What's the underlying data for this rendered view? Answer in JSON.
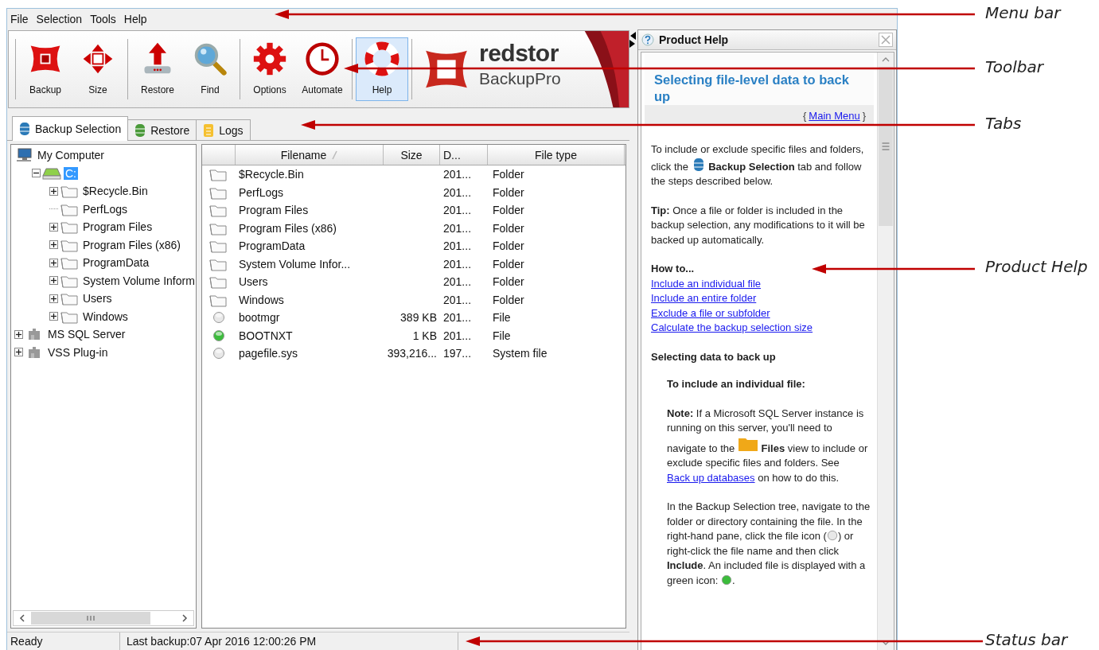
{
  "menu": [
    "File",
    "Selection",
    "Tools",
    "Help"
  ],
  "toolbar": {
    "groups": [
      [
        {
          "label": "Backup",
          "kind": "backup",
          "selected": false
        },
        {
          "label": "Size",
          "kind": "size",
          "selected": false
        }
      ],
      [
        {
          "label": "Restore",
          "kind": "restore",
          "selected": false
        },
        {
          "label": "Find",
          "kind": "find",
          "selected": false
        }
      ],
      [
        {
          "label": "Options",
          "kind": "options",
          "selected": false
        },
        {
          "label": "Automate",
          "kind": "automate",
          "selected": false
        }
      ],
      [
        {
          "label": "Help",
          "kind": "help",
          "selected": true
        }
      ]
    ],
    "logo": {
      "name": "redstor",
      "product": "BackupPro"
    }
  },
  "tabs": [
    {
      "label": "Backup Selection",
      "kind": "database",
      "selected": true
    },
    {
      "label": "Restore",
      "kind": "database",
      "selected": false
    },
    {
      "label": "Logs",
      "kind": "notes",
      "selected": false
    }
  ],
  "tree": [
    {
      "label": "My Computer",
      "kind": "computer",
      "expanded": true,
      "selected": false,
      "children": [
        {
          "label": "C:",
          "kind": "drive",
          "expandable": true,
          "expanded": true,
          "selected": true,
          "children": [
            {
              "label": "$Recycle.Bin",
              "kind": "folder",
              "expandable": true,
              "expanded": false,
              "selected": false
            },
            {
              "label": "PerfLogs",
              "kind": "folder",
              "expandable": false,
              "selected": false
            },
            {
              "label": "Program Files",
              "kind": "folder",
              "expandable": true,
              "expanded": false,
              "selected": false
            },
            {
              "label": "Program Files (x86)",
              "kind": "folder",
              "expandable": true,
              "expanded": false,
              "selected": false
            },
            {
              "label": "ProgramData",
              "kind": "folder",
              "expandable": true,
              "expanded": false,
              "selected": false
            },
            {
              "label": "System Volume Inform",
              "kind": "folder",
              "expandable": true,
              "expanded": false,
              "selected": false
            },
            {
              "label": "Users",
              "kind": "folder",
              "expandable": true,
              "expanded": false,
              "selected": false
            },
            {
              "label": "Windows",
              "kind": "folder",
              "expandable": true,
              "expanded": false,
              "selected": false
            }
          ]
        }
      ]
    },
    {
      "label": "MS SQL Server",
      "kind": "plugin",
      "expandable": true,
      "expanded": false,
      "selected": false
    },
    {
      "label": "VSS Plug-in",
      "kind": "plugin",
      "expandable": true,
      "expanded": false,
      "selected": false
    }
  ],
  "files": {
    "columns": [
      "Filename",
      "Size",
      "D...",
      "File type"
    ],
    "rows": [
      {
        "kind": "folder",
        "name": "$Recycle.Bin",
        "date": "201...",
        "type": "Folder"
      },
      {
        "kind": "folder",
        "name": "PerfLogs",
        "date": "201...",
        "type": "Folder"
      },
      {
        "kind": "folder",
        "name": "Program Files",
        "date": "201...",
        "type": "Folder"
      },
      {
        "kind": "folder",
        "name": "Program Files (x86)",
        "date": "201...",
        "type": "Folder"
      },
      {
        "kind": "folder",
        "name": "ProgramData",
        "date": "201...",
        "type": "Folder"
      },
      {
        "kind": "folder",
        "name": "System Volume Infor...",
        "date": "201...",
        "type": "Folder"
      },
      {
        "kind": "folder",
        "name": "Users",
        "date": "201...",
        "type": "Folder"
      },
      {
        "kind": "folder",
        "name": "Windows",
        "date": "201...",
        "type": "Folder"
      },
      {
        "kind": "file",
        "included": false,
        "name": "bootmgr",
        "size": "389 KB",
        "date": "201...",
        "type": "File"
      },
      {
        "kind": "file",
        "included": true,
        "name": "BOOTNXT",
        "size": "1 KB",
        "date": "201...",
        "type": "File"
      },
      {
        "kind": "file",
        "included": false,
        "name": "pagefile.sys",
        "size": "393,216...",
        "date": "197...",
        "type": "System file"
      }
    ]
  },
  "status_bar": [
    "Ready",
    "Last backup:07 Apr 2016 12:00:26 PM"
  ],
  "help": {
    "title": "Product Help",
    "heading": "Selecting file-level data to back up",
    "brace_open": "{",
    "main_menu": "Main Menu",
    "brace_close": "}",
    "blocks": [
      {
        "kind": "para",
        "parts": [
          {
            "kind": "text",
            "text": "To include or exclude specific files and folders, click the "
          },
          {
            "kind": "database"
          },
          {
            "kind": "text",
            "text": " **Backup Selection** tab and follow the steps described below."
          }
        ]
      },
      {
        "kind": "para",
        "parts": [
          {
            "kind": "text",
            "text": "**Tip:** Once a file or folder is included in the backup selection, any modifications to it will be backed up automatically."
          }
        ]
      },
      {
        "kind": "links",
        "title": "How to...",
        "items": [
          "Include an individual file",
          "Include an entire folder",
          "Exclude a file or subfolder",
          "Calculate the backup selection size"
        ]
      },
      {
        "kind": "section",
        "title": "Selecting data to back up",
        "children": [
          {
            "kind": "heading",
            "text": "To include an individual file:"
          },
          {
            "kind": "para",
            "parts": [
              {
                "kind": "text",
                "text": "**Note:** If a Microsoft SQL Server instance is running on this server, you'll need to navigate to the "
              },
              {
                "kind": "folder"
              },
              {
                "kind": "text",
                "text": " **Files** view to include or exclude specific files and folders. See "
              },
              {
                "kind": "link",
                "text": "Back up databases"
              },
              {
                "kind": "text",
                "text": " on how to do this."
              }
            ]
          },
          {
            "kind": "para",
            "parts": [
              {
                "kind": "text",
                "text": "In the Backup Selection tree, navigate to the folder or directory containing the file. In the right-hand pane, click the file icon ("
              },
              {
                "kind": "status",
                "included": false
              },
              {
                "kind": "text",
                "text": ") or right-click the file name and then click **Include**. An included file is displayed with a green icon: "
              },
              {
                "kind": "status",
                "included": true
              },
              {
                "kind": "text",
                "text": "."
              }
            ]
          }
        ]
      }
    ]
  },
  "annotations": [
    "Menu bar",
    "Toolbar",
    "Tabs",
    "Product Help",
    "Status bar"
  ]
}
